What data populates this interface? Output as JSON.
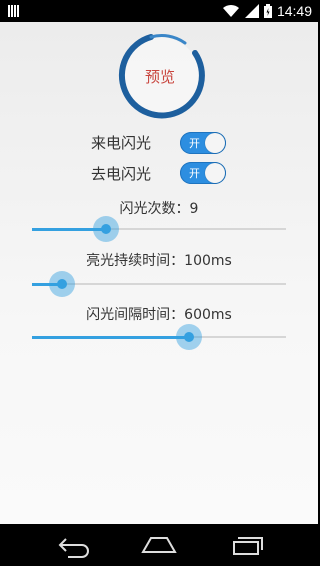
{
  "status_bar": {
    "time": "14:49",
    "icons": [
      "notification-icon",
      "wifi-icon",
      "signal-icon",
      "battery-icon"
    ]
  },
  "preview": {
    "label": "预览"
  },
  "toggles": [
    {
      "label": "来电闪光",
      "state_text": "开",
      "on": true
    },
    {
      "label": "去电闪光",
      "state_text": "开",
      "on": true
    }
  ],
  "sliders": [
    {
      "label": "闪光次数：9",
      "level": 0.29
    },
    {
      "label": "亮光持续时间：100ms",
      "level": 0.12
    },
    {
      "label": "闪光间隔时间：600ms",
      "level": 0.62
    }
  ],
  "nav": {
    "icons": [
      "back-icon",
      "home-icon",
      "recent-apps-icon"
    ]
  },
  "colors": {
    "accent": "#34a0e0",
    "preview_text": "#c9463f",
    "ring": "#1d5f9e"
  }
}
